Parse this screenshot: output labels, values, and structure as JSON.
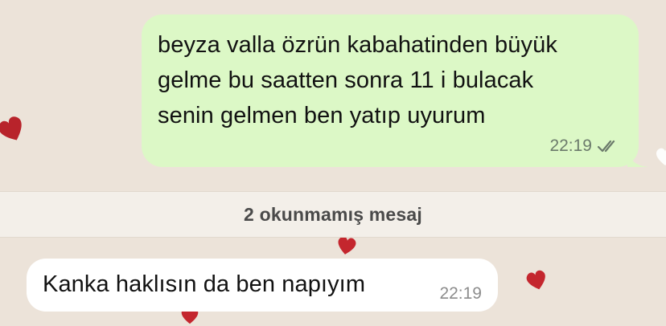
{
  "theme": {
    "chat_background": "#ece3d9",
    "outgoing_bubble": "#dcf8c6",
    "incoming_bubble": "#ffffff",
    "unread_bar": "#f3efe9",
    "heart_color": "#c4262e"
  },
  "messages": {
    "outgoing": {
      "text": "beyza valla özrün kabahatinden büyük\ngelme bu saatten sonra 11 i bulacak\nsenin gelmen ben yatıp uyurum",
      "time": "22:19",
      "status_icon": "double-check-read-icon"
    },
    "unread_divider": {
      "label": "2 okunmamış mesaj"
    },
    "incoming": {
      "text": "Kanka haklısın da ben napıyım",
      "time": "22:19"
    }
  },
  "decorations": {
    "icon": "heart-icon"
  }
}
